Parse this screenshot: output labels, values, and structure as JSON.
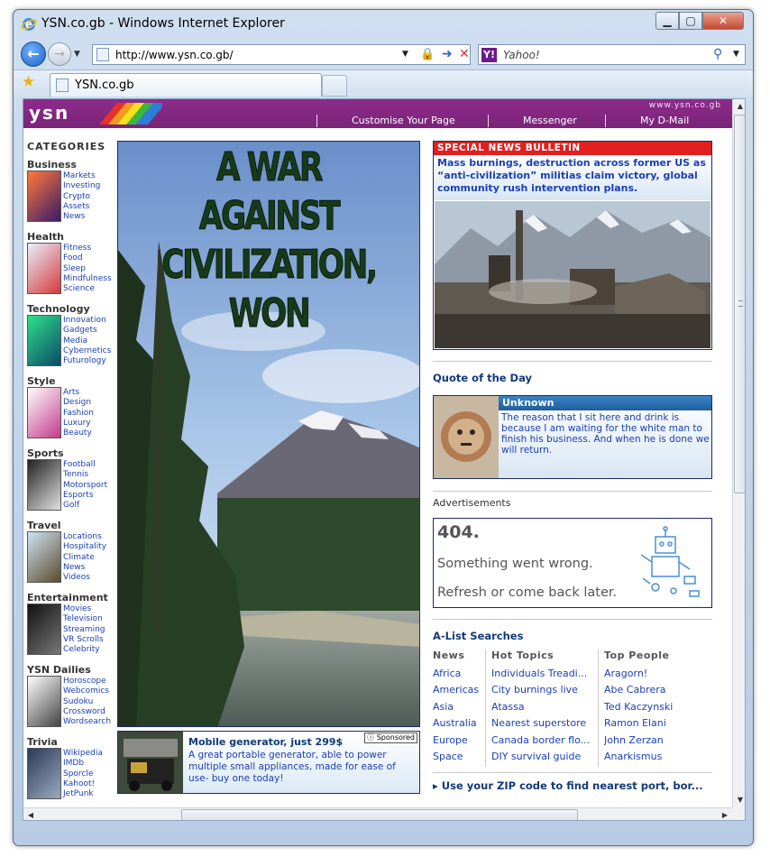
{
  "window": {
    "title": "YSN.co.gb - Windows Internet Explorer",
    "min": "▁",
    "max": "▢",
    "close": "✕"
  },
  "nav": {
    "url": "http://www.ysn.co.gb/",
    "search_placeholder": "Yahoo!",
    "tab_label": "YSN.co.gb"
  },
  "site": {
    "logo": "ysn",
    "domain": "www.ysn.co.gb",
    "toplinks": [
      "Customise Your Page",
      "Messenger",
      "My D-Mail"
    ]
  },
  "sidebar": {
    "heading": "CATEGORIES",
    "categories": [
      {
        "name": "Business",
        "links": [
          "Markets",
          "Investing",
          "Crypto",
          "Assets",
          "News"
        ]
      },
      {
        "name": "Health",
        "links": [
          "Fitness",
          "Food",
          "Sleep",
          "Mindfulness",
          "Science"
        ]
      },
      {
        "name": "Technology",
        "links": [
          "Innovation",
          "Gadgets",
          "Media",
          "Cybernetics",
          "Futurology"
        ]
      },
      {
        "name": "Style",
        "links": [
          "Arts",
          "Design",
          "Fashion",
          "Luxury",
          "Beauty"
        ]
      },
      {
        "name": "Sports",
        "links": [
          "Football",
          "Tennis",
          "Motorsport",
          "Esports",
          "Golf"
        ]
      },
      {
        "name": "Travel",
        "links": [
          "Locations",
          "Hospitality",
          "Climate",
          "News",
          "Videos"
        ]
      },
      {
        "name": "Entertainment",
        "links": [
          "Movies",
          "Television",
          "Streaming",
          "VR Scrolls",
          "Celebrity"
        ]
      },
      {
        "name": "YSN Dailies",
        "links": [
          "Horoscope",
          "Webcomics",
          "Sudoku",
          "Crossword",
          "Wordsearch"
        ]
      },
      {
        "name": "Trivia",
        "links": [
          "Wikipedia",
          "IMDb",
          "Sporcle",
          "Kahoot!",
          "JetPunk"
        ]
      }
    ]
  },
  "hero": {
    "line1": "A WAR AGAINST",
    "line2": "CIVILIZATION,",
    "line3": "WON"
  },
  "sponsored": {
    "badge": "ⓘ Sponsored",
    "title": "Mobile generator, just 299$",
    "desc": "A great portable generator, able to power multiple small appliances, made for ease of use- buy one today!"
  },
  "bulletin": {
    "bar": "SPECIAL NEWS BULLETIN",
    "headline": "Mass burnings, destruction across former US as “anti-civilization” militias claim victory, global community rush intervention plans."
  },
  "quote": {
    "heading": "Quote of the Day",
    "author": "Unknown",
    "text": "The reason that I sit here and drink is because I am waiting for the white man to finish his business. And when he is done we will return."
  },
  "ads": {
    "label": "Advertisements",
    "code": "404.",
    "line1": "Something went wrong.",
    "line2": "Refresh or come back later."
  },
  "alist": {
    "heading": "A-List Searches",
    "news_head": "News",
    "news": [
      "Africa",
      "Americas",
      "Asia",
      "Australia",
      "Europe",
      "Space"
    ],
    "topics_head": "Hot Topics",
    "topics": [
      "Individuals Treadi...",
      "City burnings live",
      "Atassa",
      "Nearest superstore",
      "Canada border flo...",
      "DIY survival guide"
    ],
    "people_head": "Top People",
    "people": [
      "Aragorn!",
      "Abe Cabrera",
      "Ted Kaczynski",
      "Ramon Elani",
      "John Zerzan",
      "Anarkismus"
    ]
  },
  "zip": "▸ Use your ZIP code to find nearest port, bor..."
}
